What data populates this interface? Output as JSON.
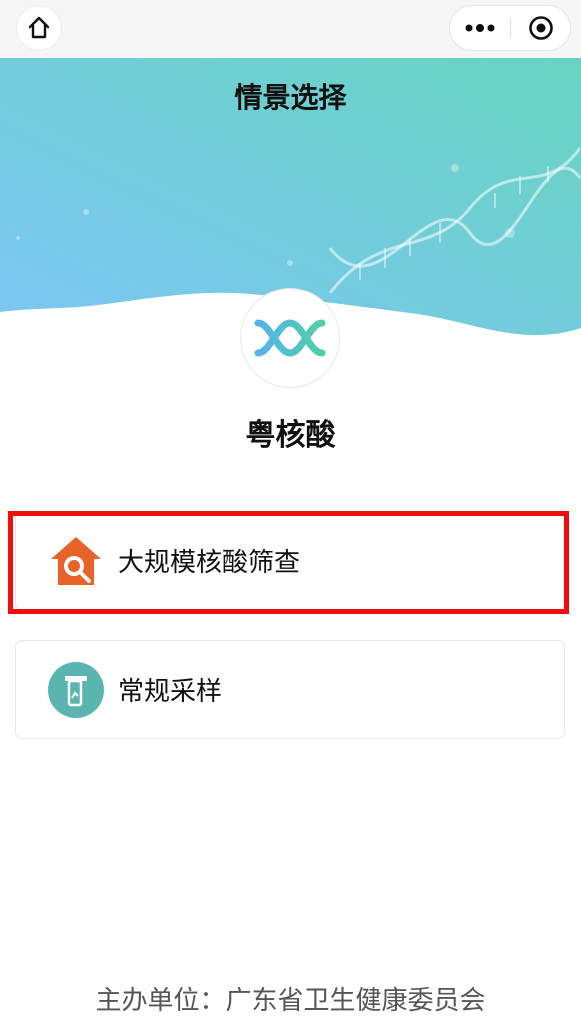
{
  "nav": {
    "home_icon": "home-icon",
    "more_icon": "more-dots-icon",
    "target_icon": "target-icon"
  },
  "header": {
    "title": "情景选择",
    "gradient": [
      "#7cc6f5",
      "#67d4bf"
    ],
    "logo_icon": "dna-logo-icon"
  },
  "app": {
    "name": "粤核酸"
  },
  "options": [
    {
      "label": "大规模核酸筛查",
      "icon": "house-search-icon",
      "icon_color": "#e8632a"
    },
    {
      "label": "常规采样",
      "icon": "sample-tube-icon",
      "icon_color": "#5ab5b0"
    }
  ],
  "footer": {
    "text": "主办单位：广东省卫生健康委员会"
  },
  "colors": {
    "highlight": "#f20d0d"
  }
}
